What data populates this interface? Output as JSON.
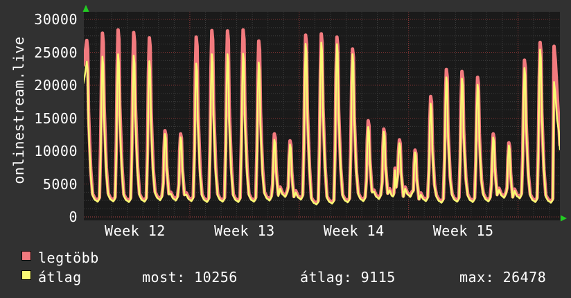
{
  "title": {
    "vertical_label": "onlinestream.live"
  },
  "colors": {
    "outer_bg": "#313131",
    "plot_bg": "#1a1a1a",
    "grid_minor": "#3e3e3e",
    "grid_major": "#843434",
    "grid_week": "#9c3a3a",
    "baseline": "#b24444",
    "legtobb": "#f27a7e",
    "atlag": "#f9f973",
    "arrow_green": "#22cc22",
    "text": "#ffffff"
  },
  "legend": {
    "entries": [
      {
        "label": "legtöbb",
        "color": "#f27a7e"
      },
      {
        "label": "átlag",
        "color": "#f9f973"
      }
    ],
    "stats": [
      {
        "label": "most:",
        "value": "10256"
      },
      {
        "label": "átlag:",
        "value": "9115"
      },
      {
        "label": "max:",
        "value": "26478"
      }
    ]
  },
  "chart_data": {
    "type": "line",
    "title": "onlinestream.live",
    "x_axis": {
      "week_labels": [
        "Week 12",
        "Week 13",
        "Week 14",
        "Week 15"
      ],
      "days_shown": 31,
      "week_starts_day_index": [
        7,
        14,
        21,
        28
      ]
    },
    "y_axis": {
      "min": 0,
      "max": 30000,
      "tick_step": 5000,
      "minor_step": 1250,
      "ticks": [
        "30000",
        "25000",
        "20000",
        "15000",
        "10000",
        "5000",
        "0"
      ]
    },
    "grid": {
      "horizontal_major_dotted_red": true,
      "vertical_day_dotted_gray": true,
      "vertical_week_dotted_red": true
    },
    "legend_position": "bottom-left",
    "series": [
      {
        "name": "legtöbb",
        "color": "#f27a7e",
        "daily_peaks": [
          26800,
          27900,
          28400,
          28000,
          27200,
          13100,
          12600,
          27300,
          28300,
          28250,
          28400,
          26700,
          12600,
          11550,
          27600,
          27800,
          27300,
          25500,
          14600,
          13350,
          11700,
          10150,
          18300,
          22400,
          22100,
          21200,
          12600,
          11250,
          23800,
          26500,
          25900
        ]
      },
      {
        "name": "átlag",
        "color": "#f9f973",
        "daily_peaks": [
          23600,
          24350,
          24700,
          24500,
          23650,
          12600,
          12100,
          23300,
          24700,
          24700,
          24800,
          23450,
          11700,
          11000,
          26300,
          26478,
          26250,
          24700,
          13650,
          12950,
          11200,
          9800,
          17200,
          21200,
          21000,
          20100,
          12050,
          10850,
          22600,
          25400,
          20500
        ]
      }
    ],
    "daily_troughs": [
      2600,
      2500,
      2550,
      2450,
      2500,
      2750,
      2700,
      2600,
      2450,
      2500,
      2450,
      2500,
      2700,
      3300,
      2850,
      2050,
      2200,
      2400,
      2600,
      2950,
      3100,
      3300,
      2600,
      2350,
      2500,
      2450,
      2550,
      3150,
      3050,
      2450,
      2350,
      2400
    ],
    "day20_secondary_bump": 7100,
    "last_value": 10256,
    "stats": {
      "most": 10256,
      "átlag": 9115,
      "max": 26478
    }
  }
}
